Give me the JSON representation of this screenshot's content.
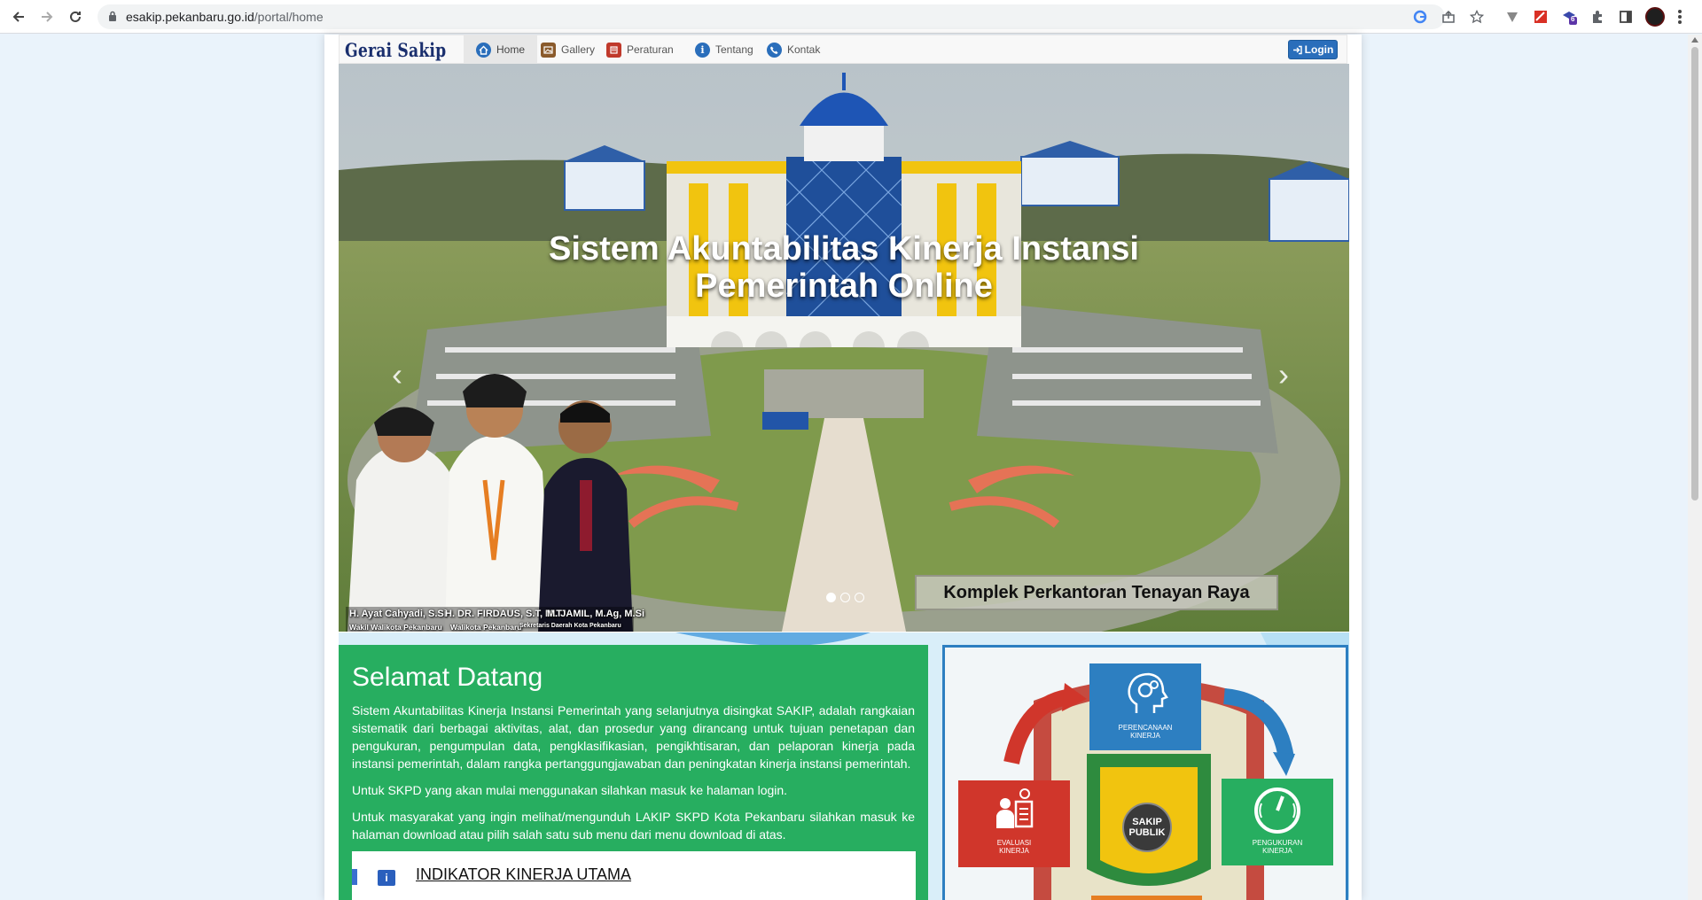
{
  "browser": {
    "url_host": "esakip.pekanbaru.go.id",
    "url_path": "/portal/home",
    "extension_badge": "6"
  },
  "navbar": {
    "brand": "Gerai Sakip",
    "items": [
      {
        "label": "Home",
        "icon": "home-icon",
        "color": "#2a6ebb",
        "active": true
      },
      {
        "label": "Gallery",
        "icon": "image-icon",
        "color": "#8a5a2b",
        "active": false
      },
      {
        "label": "Peraturan",
        "icon": "book-icon",
        "color": "#c0392b",
        "active": false
      },
      {
        "label": "Tentang",
        "icon": "info-icon",
        "color": "#2a6ebb",
        "active": false
      },
      {
        "label": "Kontak",
        "icon": "phone-icon",
        "color": "#2a6ebb",
        "active": false
      }
    ],
    "login_label": "Login"
  },
  "carousel": {
    "title_line1": "Sistem Akuntabilitas Kinerja Instansi",
    "title_line2": "Pemerintah Online",
    "caption": "Komplek Perkantoran Tenayan Raya",
    "active_slide": 1,
    "slide_count": 3,
    "officials": [
      {
        "name": "H. Ayat Cahyadi, S.Si",
        "role": "Wakil Walikota Pekanbaru"
      },
      {
        "name": "H. DR. FIRDAUS, S.T, M.T",
        "role": "Walikota Pekanbaru"
      },
      {
        "name": "M. JAMIL, M.Ag, M.Si",
        "role": "Sekretaris Daerah Kota Pekanbaru"
      }
    ]
  },
  "welcome": {
    "heading": "Selamat Datang",
    "paragraphs": [
      "Sistem Akuntabilitas Kinerja Instansi Pemerintah yang selanjutnya disingkat SAKIP, adalah rangkaian sistematik dari berbagai aktivitas, alat, dan prosedur yang dirancang untuk tujuan penetapan dan pengukuran, pengumpulan data, pengklasifikasian, pengikhtisaran, dan pelaporan kinerja pada instansi pemerintah, dalam rangka pertanggungjawaban dan peningkatan kinerja instansi pemerintah.",
      "Untuk SKPD yang akan mulai menggunakan silahkan masuk ke halaman login.",
      "Untuk masyarakat yang ingin melihat/mengunduh LAKIP SKPD Kota Pekanbaru silahkan masuk ke halaman download atau pilih salah satu sub menu dari menu download di atas."
    ],
    "iku_title": "INDIKATOR KINERJA UTAMA"
  },
  "cycle": {
    "top": "PERENCANAAN KINERJA",
    "left": "EVALUASI KINERJA",
    "right": "PENGUKURAN KINERJA",
    "center_line1": "SAKIP",
    "center_line2": "PUBLIK"
  },
  "colors": {
    "accent_green": "#27ae60",
    "login_blue": "#2a6ebb",
    "brand_navy": "#1a2f6e"
  }
}
